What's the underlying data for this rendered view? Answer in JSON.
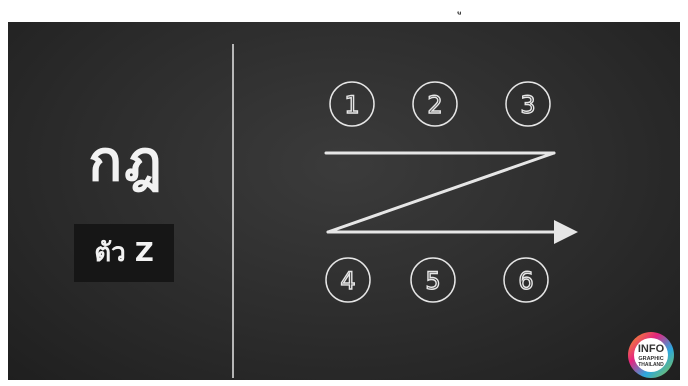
{
  "top_mark": "ู",
  "left_panel": {
    "title": "กฎ",
    "tag": "ตัว Z"
  },
  "top_steps": [
    "1",
    "2",
    "3"
  ],
  "bottom_steps": [
    "4",
    "5",
    "6"
  ],
  "logo": {
    "line1": "INFO",
    "line2": "GRAPHIC",
    "line3": "THAILAND"
  },
  "colors": {
    "board": "#2c2c2c",
    "chalk": "#e6e6e6",
    "tag_bg": "#161616"
  }
}
